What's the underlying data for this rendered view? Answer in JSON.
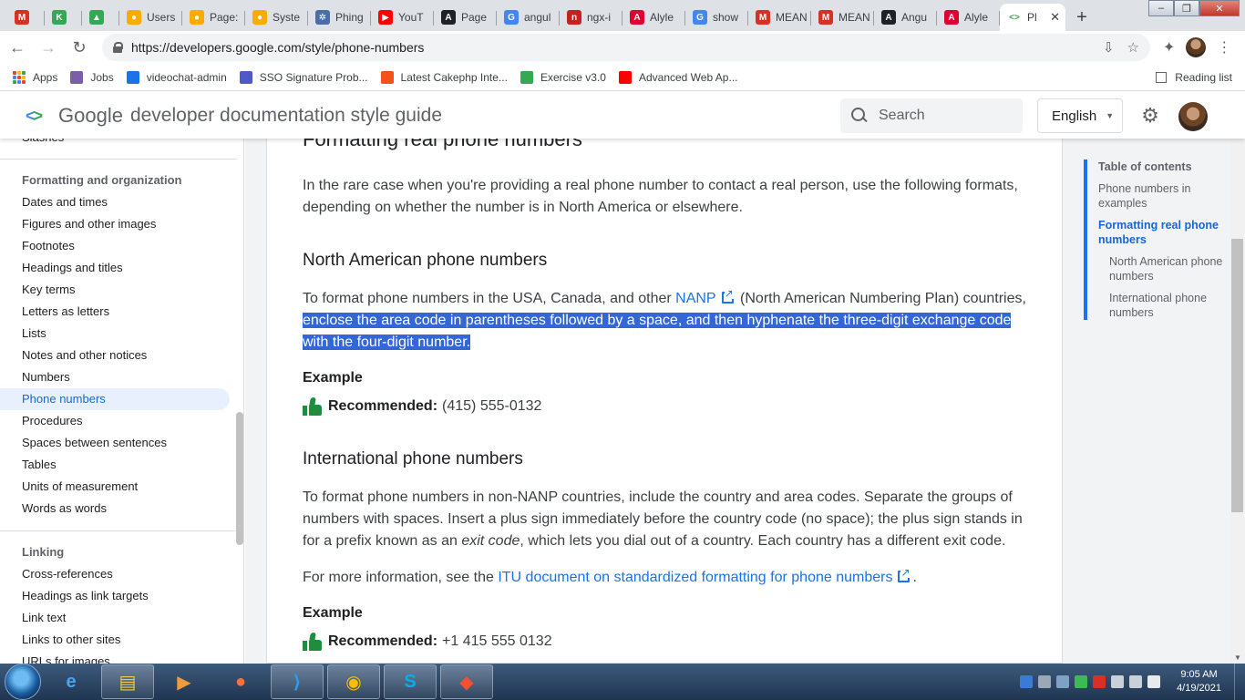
{
  "browser": {
    "tabs": [
      {
        "label": "",
        "favicon_color": "#d93025",
        "favicon_glyph": "M"
      },
      {
        "label": "",
        "favicon_color": "#34a853",
        "favicon_glyph": "K"
      },
      {
        "label": "",
        "favicon_color": "#34a853",
        "favicon_glyph": "▲"
      },
      {
        "label": "Users",
        "favicon_color": "#f9ab00",
        "favicon_glyph": "●"
      },
      {
        "label": "Page:",
        "favicon_color": "#f9ab00",
        "favicon_glyph": "●"
      },
      {
        "label": "Syste",
        "favicon_color": "#f9ab00",
        "favicon_glyph": "●"
      },
      {
        "label": "Phing",
        "favicon_color": "#4a6da7",
        "favicon_glyph": "✲"
      },
      {
        "label": "YouT",
        "favicon_color": "#ff0000",
        "favicon_glyph": "▶"
      },
      {
        "label": "Page",
        "favicon_color": "#202124",
        "favicon_glyph": "A"
      },
      {
        "label": "angul",
        "favicon_color": "#4285f4",
        "favicon_glyph": "G"
      },
      {
        "label": "ngx-i",
        "favicon_color": "#c5221f",
        "favicon_glyph": "n"
      },
      {
        "label": "Alyle",
        "favicon_color": "#dd0031",
        "favicon_glyph": "A"
      },
      {
        "label": "show",
        "favicon_color": "#4285f4",
        "favicon_glyph": "G"
      },
      {
        "label": "MEAN",
        "favicon_color": "#d93025",
        "favicon_glyph": "M"
      },
      {
        "label": "MEAN",
        "favicon_color": "#d93025",
        "favicon_glyph": "M"
      },
      {
        "label": "Angu",
        "favicon_color": "#202124",
        "favicon_glyph": "A"
      },
      {
        "label": "Alyle",
        "favicon_color": "#dd0031",
        "favicon_glyph": "A"
      }
    ],
    "active_tab": {
      "label": "Pl",
      "close_glyph": "✕"
    },
    "new_tab_glyph": "+",
    "window_controls": {
      "minimize": "–",
      "maximize": "❐",
      "close": "✕"
    },
    "url": "https://developers.google.com/style/phone-numbers",
    "bookmarks": [
      {
        "label": "Apps",
        "icon": "apps-grid-icon"
      },
      {
        "label": "Jobs",
        "color": "#7b5ea7"
      },
      {
        "label": "videochat-admin",
        "color": "#1a73e8"
      },
      {
        "label": "SSO Signature Prob...",
        "color": "#5059c9"
      },
      {
        "label": "Latest Cakephp Inte...",
        "color": "#f4511e"
      },
      {
        "label": "Exercise v3.0",
        "color": "#34a853"
      },
      {
        "label": "Advanced Web Ap...",
        "color": "#ff0000"
      }
    ],
    "reading_list": "Reading list"
  },
  "site": {
    "brand_google": "Google",
    "brand_title": "developer documentation style guide",
    "search_placeholder": "Search",
    "language": "English"
  },
  "leftnav": {
    "partial_top": "Slashes",
    "section1_title": "Formatting and organization",
    "section1_items": [
      "Dates and times",
      "Figures and other images",
      "Footnotes",
      "Headings and titles",
      "Key terms",
      "Letters as letters",
      "Lists",
      "Notes and other notices",
      "Numbers",
      "Phone numbers",
      "Procedures",
      "Spaces between sentences",
      "Tables",
      "Units of measurement",
      "Words as words"
    ],
    "active_item": "Phone numbers",
    "section2_title": "Linking",
    "section2_items": [
      "Cross-references",
      "Headings as link targets",
      "Link text",
      "Links to other sites",
      "URLs for images"
    ]
  },
  "article": {
    "h2": "Formatting real phone numbers",
    "intro": "In the rare case when you're providing a real phone number to contact a real person, use the following formats, depending on whether the number is in North America or elsewhere.",
    "na_heading": "North American phone numbers",
    "na_text_before": "To format phone numbers in the USA, Canada, and other",
    "na_link": "NANP",
    "na_text_after": "(North American Numbering Plan) countries,",
    "na_highlighted": "enclose the area code in parentheses followed by a space, and then hyphenate the three-digit exchange code with the four-digit number.",
    "example_label": "Example",
    "recommended_label": "Recommended:",
    "na_example": "(415) 555-0132",
    "intl_heading": "International phone numbers",
    "intl_text_1": "To format phone numbers in non-NANP countries, include the country and area codes. Separate the groups of numbers with spaces. Insert a plus sign immediately before the country code (no space); the plus sign stands in for a prefix known as an",
    "intl_italic": "exit code",
    "intl_text_2": ", which lets you dial out of a country. Each country has a different exit code.",
    "more_info_before": "For more information, see the",
    "more_info_link": "ITU document on standardized formatting for phone numbers",
    "more_info_after": ".",
    "example_label_2": "Example",
    "intl_example": "+1 415 555 0132"
  },
  "toc": {
    "title": "Table of contents",
    "items": [
      "Phone numbers in examples",
      "Formatting real phone numbers"
    ],
    "active": "Formatting real phone numbers",
    "subitems": [
      "North American phone numbers",
      "International phone numbers"
    ]
  },
  "taskbar": {
    "apps": [
      "ie-icon",
      "file-explorer-icon",
      "media-player-icon",
      "firefox-icon",
      "vscode-icon",
      "chrome-icon",
      "skype-icon",
      "git-icon"
    ],
    "time": "9:05 AM",
    "date": "4/19/2021"
  },
  "colors": {
    "accent": "#1a73e8",
    "active_nav_bg": "#e8f0fe",
    "highlight": "#3367d6",
    "recommended_green": "#1e8e3e"
  }
}
